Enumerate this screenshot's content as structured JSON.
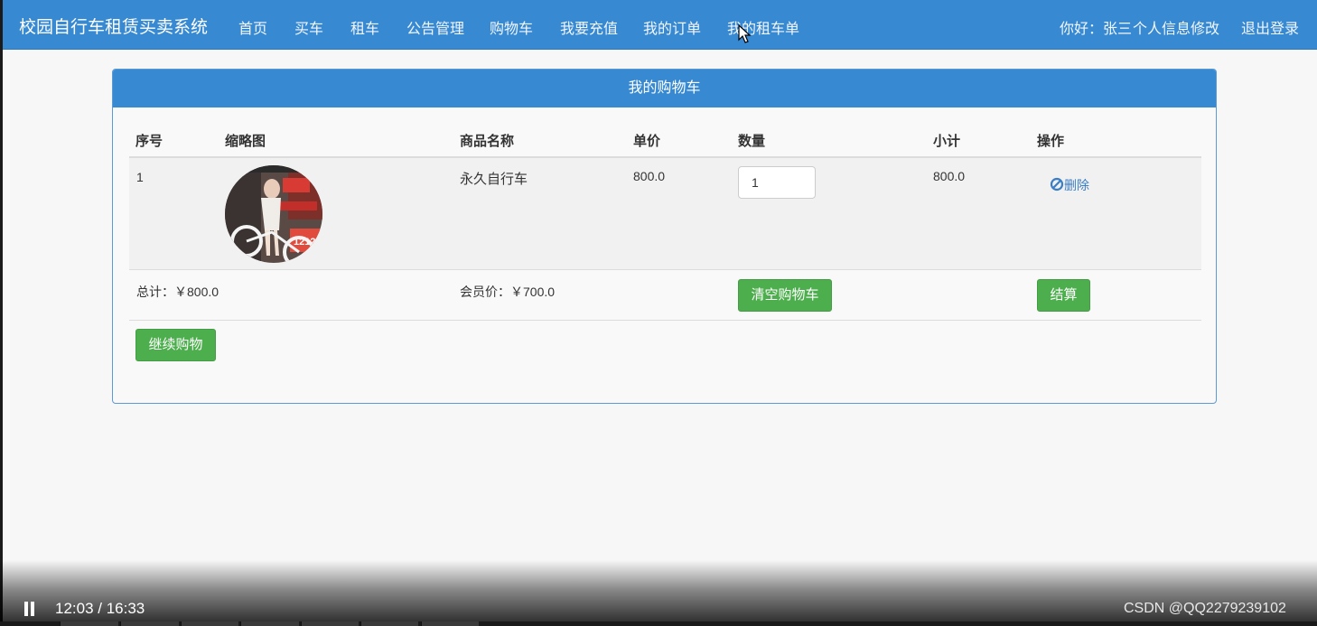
{
  "navbar": {
    "brand": "校园自行车租赁买卖系统",
    "links": [
      "首页",
      "买车",
      "租车",
      "公告管理",
      "购物车",
      "我要充值",
      "我的订单",
      "我的租车单"
    ],
    "greeting": "你好：张三",
    "profile_link": "个人信息修改",
    "logout_link": "退出登录"
  },
  "panel": {
    "title": "我的购物车",
    "columns": [
      "序号",
      "缩略图",
      "商品名称",
      "单价",
      "数量",
      "小计",
      "操作"
    ],
    "rows": [
      {
        "index": "1",
        "name": "永久自行车",
        "price": "800.0",
        "quantity": "1",
        "subtotal": "800.0",
        "delete_label": "删除"
      }
    ],
    "total_label": "总计：￥800.0",
    "member_price_label": "会员价：￥700.0",
    "clear_cart_button": "清空购物车",
    "checkout_button": "结算",
    "continue_button": "继续购物"
  },
  "player": {
    "time": "12:03 / 16:33",
    "watermark": "CSDN @QQ2279239102"
  },
  "colors": {
    "navbar": "#3789d2",
    "panel_heading": "#3789d2",
    "button_green": "#4cae4c",
    "link_blue": "#3a7ec4"
  }
}
